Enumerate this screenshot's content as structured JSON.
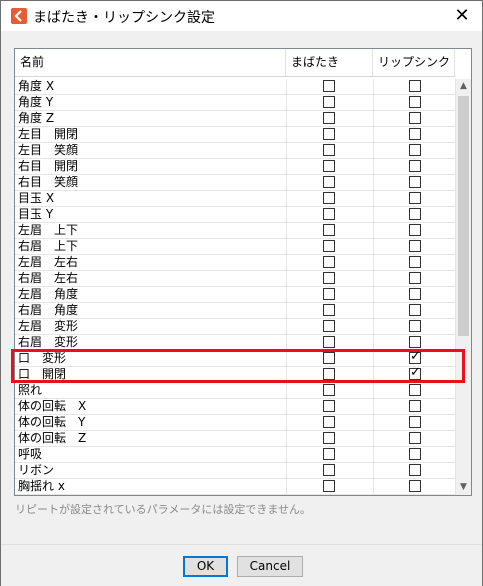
{
  "window": {
    "title": "まばたき・リップシンク設定",
    "close_glyph": "✕"
  },
  "table": {
    "headers": {
      "name": "名前",
      "blink": "まばたき",
      "lipsync": "リップシンク"
    },
    "rows": [
      {
        "name": "角度 X",
        "blink": false,
        "lipsync": false
      },
      {
        "name": "角度 Y",
        "blink": false,
        "lipsync": false
      },
      {
        "name": "角度 Z",
        "blink": false,
        "lipsync": false
      },
      {
        "name": "左目　開閉",
        "blink": false,
        "lipsync": false
      },
      {
        "name": "左目　笑顔",
        "blink": false,
        "lipsync": false
      },
      {
        "name": "右目　開閉",
        "blink": false,
        "lipsync": false
      },
      {
        "name": "右目　笑顔",
        "blink": false,
        "lipsync": false
      },
      {
        "name": "目玉 X",
        "blink": false,
        "lipsync": false
      },
      {
        "name": "目玉 Y",
        "blink": false,
        "lipsync": false
      },
      {
        "name": "左眉　上下",
        "blink": false,
        "lipsync": false
      },
      {
        "name": "右眉　上下",
        "blink": false,
        "lipsync": false
      },
      {
        "name": "左眉　左右",
        "blink": false,
        "lipsync": false
      },
      {
        "name": "右眉　左右",
        "blink": false,
        "lipsync": false
      },
      {
        "name": "左眉　角度",
        "blink": false,
        "lipsync": false
      },
      {
        "name": "右眉　角度",
        "blink": false,
        "lipsync": false
      },
      {
        "name": "左眉　変形",
        "blink": false,
        "lipsync": false
      },
      {
        "name": "右眉　変形",
        "blink": false,
        "lipsync": false
      },
      {
        "name": "口　変形",
        "blink": false,
        "lipsync": true
      },
      {
        "name": "口　開閉",
        "blink": false,
        "lipsync": true
      },
      {
        "name": "照れ",
        "blink": false,
        "lipsync": false
      },
      {
        "name": "体の回転　X",
        "blink": false,
        "lipsync": false
      },
      {
        "name": "体の回転　Y",
        "blink": false,
        "lipsync": false
      },
      {
        "name": "体の回転　Z",
        "blink": false,
        "lipsync": false
      },
      {
        "name": "呼吸",
        "blink": false,
        "lipsync": false
      },
      {
        "name": "リボン",
        "blink": false,
        "lipsync": false
      },
      {
        "name": "胸揺れ x",
        "blink": false,
        "lipsync": false
      }
    ]
  },
  "scrollbar": {
    "up_glyph": "▲",
    "down_glyph": "▼"
  },
  "note": "リピートが設定されているパラメータには設定できません。",
  "buttons": {
    "ok": "OK",
    "cancel": "Cancel"
  },
  "colors": {
    "highlight": "#e8101c",
    "ok_focus": "#0078d7",
    "app_icon": "#e85c33"
  }
}
